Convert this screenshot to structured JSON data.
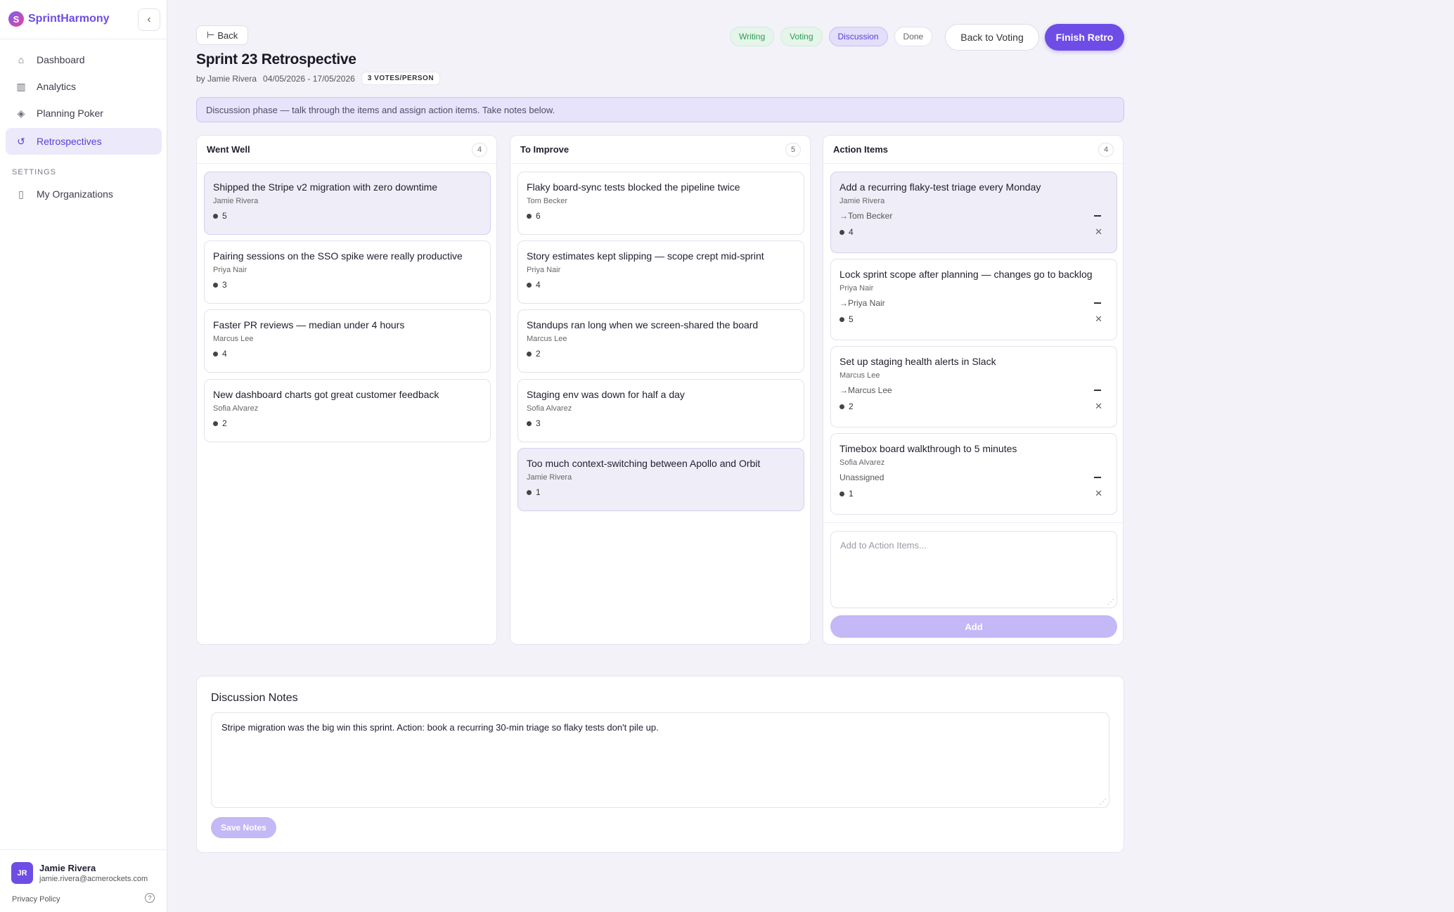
{
  "app": {
    "name": "SprintHarmony",
    "logo_letter": "S",
    "collapse_label": "‹"
  },
  "sidebar": {
    "items": [
      {
        "label": "Dashboard",
        "icon": "⌂"
      },
      {
        "label": "Analytics",
        "icon": "▥"
      },
      {
        "label": "Planning Poker",
        "icon": "◈"
      },
      {
        "label": "Retrospectives",
        "icon": "↺"
      }
    ],
    "settings_label": "SETTINGS",
    "settings_items": [
      {
        "label": "My Organizations",
        "icon": "▯"
      }
    ]
  },
  "user": {
    "initials": "JR",
    "name": "Jamie Rivera",
    "email": "jamie.rivera@acmerockets.com",
    "privacy": "Privacy Policy",
    "help": "?"
  },
  "header": {
    "back_label": "Back",
    "title": "Sprint 23 Retrospective",
    "author": "by Jamie Rivera",
    "dates": "04/05/2026 - 17/05/2026",
    "votes_badge": "3 VOTES/PERSON",
    "phases": [
      "Writing",
      "Voting",
      "Discussion",
      "Done"
    ],
    "back_to_voting": "Back to Voting",
    "finish": "Finish Retro"
  },
  "banner": "Discussion phase — talk through the items and assign action items. Take notes below.",
  "columns": [
    {
      "title": "Went Well",
      "count": "4",
      "cards": [
        {
          "text": "Shipped the Stripe v2 migration with zero downtime",
          "author": "Jamie Rivera",
          "votes": "5"
        },
        {
          "text": "Pairing sessions on the SSO spike were really productive",
          "author": "Priya Nair",
          "votes": "3"
        },
        {
          "text": "Faster PR reviews — median under 4 hours",
          "author": "Marcus Lee",
          "votes": "4"
        },
        {
          "text": "New dashboard charts got great customer feedback",
          "author": "Sofia Alvarez",
          "votes": "2"
        }
      ]
    },
    {
      "title": "To Improve",
      "count": "5",
      "cards": [
        {
          "text": "Flaky board-sync tests blocked the pipeline twice",
          "author": "Tom Becker",
          "votes": "6"
        },
        {
          "text": "Story estimates kept slipping — scope crept mid-sprint",
          "author": "Priya Nair",
          "votes": "4"
        },
        {
          "text": "Standups ran long when we screen-shared the board",
          "author": "Marcus Lee",
          "votes": "2"
        },
        {
          "text": "Staging env was down for half a day",
          "author": "Sofia Alvarez",
          "votes": "3"
        },
        {
          "text": "Too much context-switching between Apollo and Orbit",
          "author": "Jamie Rivera",
          "votes": "1"
        }
      ]
    },
    {
      "title": "Action Items",
      "count": "4",
      "cards": [
        {
          "text": "Add a recurring flaky-test triage every Monday",
          "author": "Jamie Rivera",
          "assignee": "→Tom Becker",
          "votes": "4"
        },
        {
          "text": "Lock sprint scope after planning — changes go to backlog",
          "author": "Priya Nair",
          "assignee": "→Priya Nair",
          "votes": "5"
        },
        {
          "text": "Set up staging health alerts in Slack",
          "author": "Marcus Lee",
          "assignee": "→Marcus Lee",
          "votes": "2"
        },
        {
          "text": "Timebox board walkthrough to 5 minutes",
          "author": "Sofia Alvarez",
          "assignee": "Unassigned",
          "votes": "1"
        }
      ],
      "add_placeholder": "Add to Action Items...",
      "add_label": "Add"
    }
  ],
  "notes": {
    "title": "Discussion Notes",
    "value": "Stripe migration was the big win this sprint. Action: book a recurring 30-min triage so flaky tests don't pile up.",
    "save_label": "Save Notes"
  }
}
